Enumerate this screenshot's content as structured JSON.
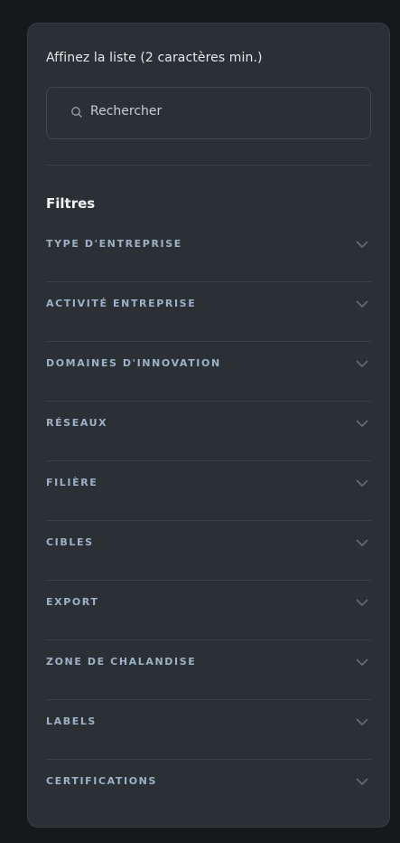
{
  "panel": {
    "hint": "Affinez la liste (2 caractères min.)",
    "search": {
      "placeholder": "Rechercher"
    },
    "filters_title": "Filtres",
    "filters": [
      {
        "label": "TYPE D'ENTREPRISE",
        "icon": "chevron-down-icon"
      },
      {
        "label": "ACTIVITÉ ENTREPRISE",
        "icon": "chevron-down-icon"
      },
      {
        "label": "DOMAINES D'INNOVATION",
        "icon": "chevron-down-icon"
      },
      {
        "label": "RÉSEAUX",
        "icon": "chevron-down-icon"
      },
      {
        "label": "FILIÈRE",
        "icon": "chevron-down-icon"
      },
      {
        "label": "CIBLES",
        "icon": "chevron-down-icon"
      },
      {
        "label": "EXPORT",
        "icon": "chevron-down-icon"
      },
      {
        "label": "ZONE DE CHALANDISE",
        "icon": "chevron-down-icon"
      },
      {
        "label": "LABELS",
        "icon": "chevron-down-icon"
      },
      {
        "label": "CERTIFICATIONS",
        "icon": "chevron-down-icon"
      }
    ]
  },
  "colors": {
    "background": "#16191c",
    "panel": "#2b3035",
    "filter_label": "#9eb1c6",
    "divider": "#3a4046"
  }
}
